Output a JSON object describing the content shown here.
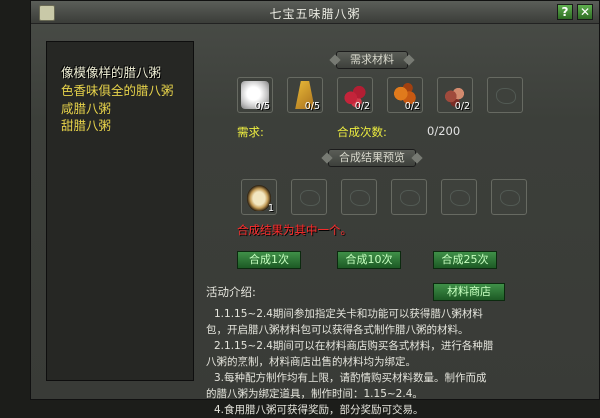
{
  "window": {
    "title": "七宝五味腊八粥",
    "help_label": "?",
    "close_label": "✕"
  },
  "recipe_list": [
    {
      "label": "像模像样的腊八粥",
      "active": true
    },
    {
      "label": "色香味俱全的腊八粥",
      "active": false
    },
    {
      "label": "咸腊八粥",
      "active": false
    },
    {
      "label": "甜腊八粥",
      "active": false
    }
  ],
  "materials": {
    "header": "需求材料",
    "slots": [
      {
        "icon": "dumpling-icon",
        "count": "0/5"
      },
      {
        "icon": "grain-icon",
        "count": "0/5"
      },
      {
        "icon": "red-bean-icon",
        "count": "0/2"
      },
      {
        "icon": "jujube-icon",
        "count": "0/2"
      },
      {
        "icon": "nut-icon",
        "count": "0/2"
      },
      {
        "icon": "empty-slot-icon",
        "count": ""
      }
    ],
    "require_label": "需求:",
    "synth_label": "合成次数:",
    "synth_value": "0/200"
  },
  "preview": {
    "header": "合成结果预览",
    "slots": [
      {
        "icon": "porridge-bowl-icon",
        "count": "1"
      },
      {
        "icon": "empty-slot-icon",
        "count": ""
      },
      {
        "icon": "empty-slot-icon",
        "count": ""
      },
      {
        "icon": "empty-slot-icon",
        "count": ""
      },
      {
        "icon": "empty-slot-icon",
        "count": ""
      },
      {
        "icon": "empty-slot-icon",
        "count": ""
      }
    ],
    "status": "合成结果为其中一个。"
  },
  "buttons": {
    "synth1": "合成1次",
    "synth10": "合成10次",
    "synth25": "合成25次",
    "shop": "材料商店"
  },
  "activity": {
    "label": "活动介绍:",
    "lines": [
      "1.1.15~2.4期间参加指定关卡和功能可以获得腊八粥材料",
      "包，开启腊八粥材料包可以获得各式制作腊八粥的材料。",
      "2.1.15~2.4期间可以在材料商店购买各式材料，进行各种腊",
      "八粥的烹制，材料商店出售的材料均为绑定。",
      "3.每种配方制作均有上限，请酌情购买材料数量。制作而成",
      "的腊八粥为绑定道具，制作时间：1.15~2.4。",
      "4.食用腊八粥可获得奖励，部分奖励可交易。"
    ]
  },
  "colors": {
    "accent_yellow": "#e6d24a",
    "status_red": "#ff2b2b",
    "button_green": "#2f7a36"
  }
}
